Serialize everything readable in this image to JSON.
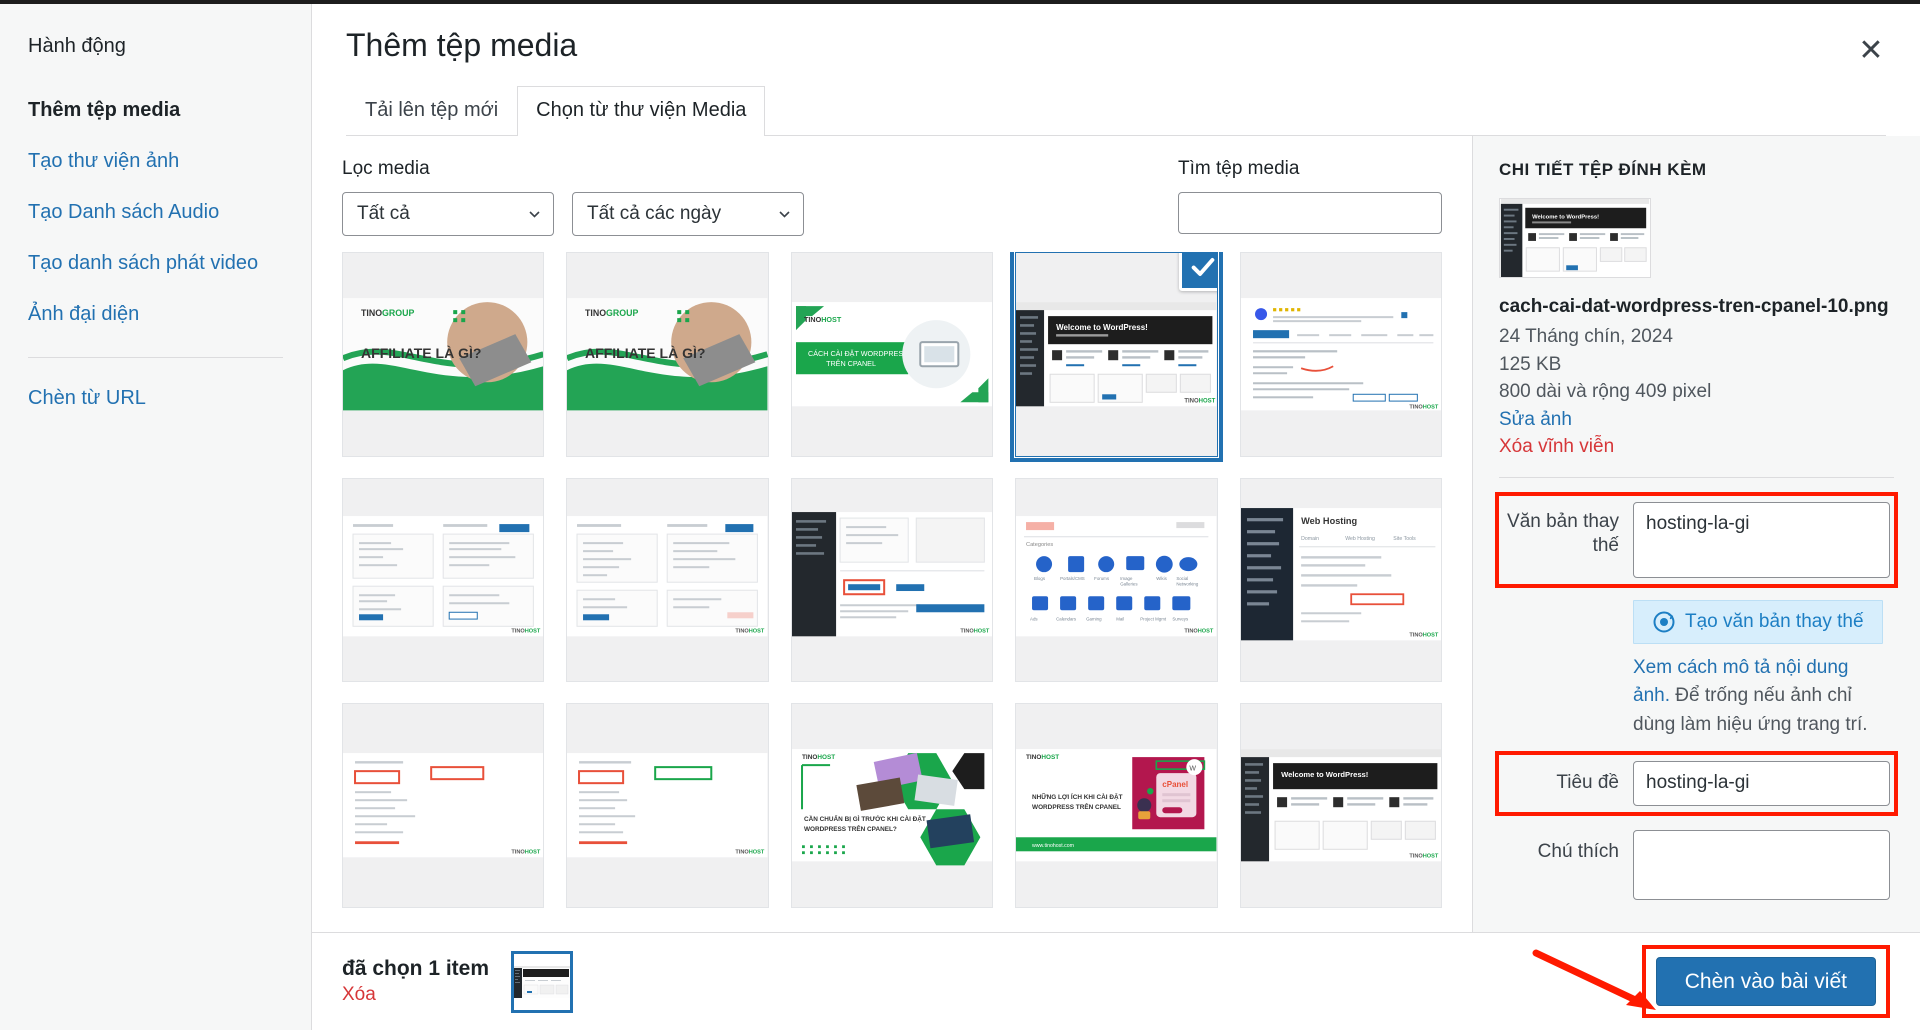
{
  "sidebar": {
    "heading": "Hành động",
    "items": [
      {
        "label": "Thêm tệp media",
        "active": true
      },
      {
        "label": "Tạo thư viện ảnh",
        "active": false
      },
      {
        "label": "Tạo Danh sách Audio",
        "active": false
      },
      {
        "label": "Tạo danh sách phát video",
        "active": false
      },
      {
        "label": "Ảnh đại diện",
        "active": false
      }
    ],
    "after_separator": {
      "label": "Chèn từ URL"
    }
  },
  "modal": {
    "title": "Thêm tệp media",
    "close_icon": "close-icon",
    "tabs": [
      {
        "label": "Tải lên tệp mới",
        "active": false
      },
      {
        "label": "Chọn từ thư viện Media",
        "active": true
      }
    ]
  },
  "toolbar": {
    "filter_label": "Lọc media",
    "type_filter": {
      "value": "Tất cả",
      "icon": "chevron-down-icon"
    },
    "date_filter": {
      "value": "Tất cả các ngày",
      "icon": "chevron-down-icon"
    },
    "search_label": "Tìm tệp media",
    "search_value": "",
    "search_placeholder": ""
  },
  "grid": {
    "items": [
      {
        "kind": "affiliate",
        "title": "AFFILIATE LÀ GÌ?",
        "brand": "TINOGROUP",
        "selected": false
      },
      {
        "kind": "affiliate",
        "title": "AFFILIATE LÀ GÌ?",
        "brand": "TINOGROUP",
        "selected": false
      },
      {
        "kind": "cpanel-banner",
        "title": "CÁCH CÀI ĐẶT WORDPRESS TRÊN CPANEL",
        "brand": "TINOHOST",
        "selected": false
      },
      {
        "kind": "wp-dashboard",
        "title": "Welcome to WordPress!",
        "brand": "TINOHOST",
        "selected": true
      },
      {
        "kind": "wp-form",
        "title": "",
        "brand": "TINOHOST",
        "selected": false
      },
      {
        "kind": "cpanel-form",
        "title": "",
        "brand": "TINOHOST",
        "selected": false
      },
      {
        "kind": "cpanel-form",
        "title": "",
        "brand": "TINOHOST",
        "selected": false
      },
      {
        "kind": "wp-install",
        "title": "",
        "brand": "TINOHOST",
        "selected": false
      },
      {
        "kind": "cpanel-icons",
        "title": "",
        "brand": "TINOHOST",
        "selected": false
      },
      {
        "kind": "webhosting",
        "title": "Web Hosting",
        "brand": "TINOHOST",
        "selected": false
      },
      {
        "kind": "cpanel-list",
        "title": "",
        "brand": "TINOHOST",
        "selected": false
      },
      {
        "kind": "cpanel-list",
        "title": "",
        "brand": "TINOHOST",
        "selected": false
      },
      {
        "kind": "prepare-banner",
        "title": "CẦN CHUẨN BỊ GÌ TRƯỚC KHI CÀI ĐẶT WORDPRESS TRÊN CPANEL?",
        "brand": "TINOHOST",
        "selected": false
      },
      {
        "kind": "benefit-banner",
        "title": "NHỮNG LỢI ÍCH KHI CÀI ĐẶT WORDPRESS TRÊN CPANEL",
        "brand": "TINOHOST",
        "selected": false
      },
      {
        "kind": "wp-dashboard",
        "title": "Welcome to WordPress!",
        "brand": "TINOHOST",
        "selected": false
      }
    ]
  },
  "details": {
    "heading": "CHI TIẾT TỆP ĐÍNH KÈM",
    "filename": "cach-cai-dat-wordpress-tren-cpanel-10.png",
    "date": "24 Tháng chín, 2024",
    "filesize": "125 KB",
    "dimensions": "800 dài và rộng 409 pixel",
    "edit_link": "Sửa ảnh",
    "delete_link": "Xóa vĩnh viễn",
    "fields": {
      "alt_label": "Văn bản thay thế",
      "alt_value": "hosting-la-gi",
      "ai_button": "Tạo văn bản thay thế",
      "ai_button_icon": "ai-circle-icon",
      "help_link": "Xem cách mô tả nội dung ảnh.",
      "help_text": "Để trống nếu ảnh chỉ dùng làm hiệu ứng trang trí.",
      "title_label": "Tiêu đề",
      "title_value": "hosting-la-gi",
      "caption_label": "Chú thích",
      "caption_value": ""
    }
  },
  "footer": {
    "selection_count": "đã chọn 1 item",
    "clear_label": "Xóa",
    "insert_label": "Chèn vào bài viết",
    "annotation_icon": "red-arrow-icon"
  },
  "colors": {
    "accent": "#2271b1",
    "danger": "#d63638",
    "highlight": "#ff1a00",
    "brand_green": "#1aa64b",
    "panel_bg": "#f6f7f7"
  }
}
